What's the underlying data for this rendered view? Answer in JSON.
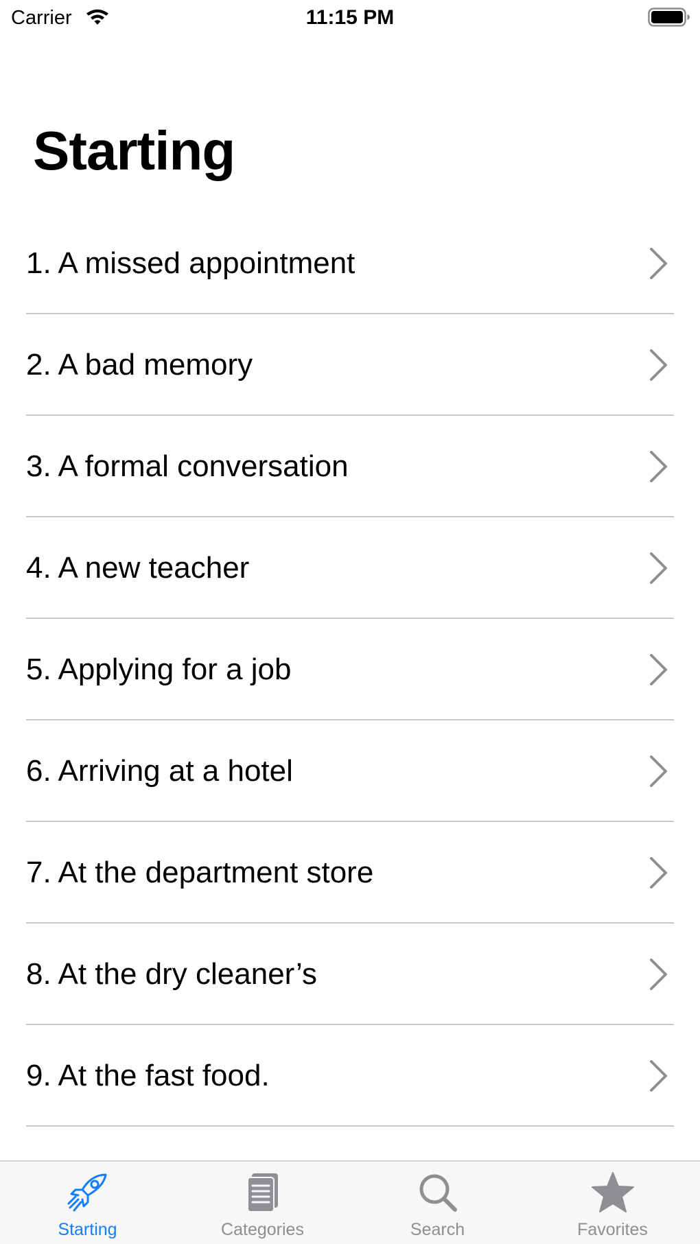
{
  "status_bar": {
    "carrier": "Carrier",
    "time": "11:15 PM"
  },
  "page": {
    "title": "Starting"
  },
  "list": {
    "items": [
      {
        "label": "1. A missed appointment"
      },
      {
        "label": "2. A bad memory"
      },
      {
        "label": "3. A formal conversation"
      },
      {
        "label": "4. A new teacher"
      },
      {
        "label": "5. Applying for a job"
      },
      {
        "label": "6. Arriving at a hotel"
      },
      {
        "label": "7. At the department store"
      },
      {
        "label": "8. At the dry cleaner’s"
      },
      {
        "label": "9. At the fast food."
      }
    ],
    "chevron_icon": "chevron-right-icon"
  },
  "tab_bar": {
    "tabs": [
      {
        "label": "Starting",
        "icon": "rocket-icon",
        "active": true
      },
      {
        "label": "Categories",
        "icon": "document-icon",
        "active": false
      },
      {
        "label": "Search",
        "icon": "magnifier-icon",
        "active": false
      },
      {
        "label": "Favorites",
        "icon": "star-icon",
        "active": false
      }
    ]
  },
  "colors": {
    "accent": "#147efb",
    "inactive": "#8e8e93",
    "divider": "#c8c7cc",
    "chevron": "#8e8e93"
  }
}
